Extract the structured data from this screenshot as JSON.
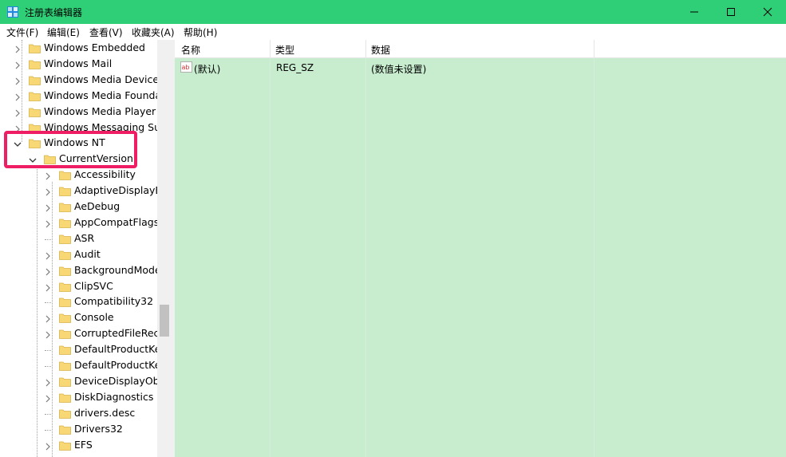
{
  "window": {
    "title": "注册表编辑器"
  },
  "menu": [
    "文件(F)",
    "编辑(E)",
    "查看(V)",
    "收藏夹(A)",
    "帮助(H)"
  ],
  "tree": {
    "top": [
      "Windows Embedded",
      "Windows Mail",
      "Windows Media Device M",
      "Windows Media Foundat",
      "Windows Media Player N",
      "Windows Messaging Sub"
    ],
    "expanded_parent": "Windows NT",
    "expanded_child": "CurrentVersion",
    "children": [
      {
        "label": "Accessibility",
        "expandable": true
      },
      {
        "label": "AdaptiveDisplayBr",
        "expandable": true
      },
      {
        "label": "AeDebug",
        "expandable": true
      },
      {
        "label": "AppCompatFlags",
        "expandable": true
      },
      {
        "label": "ASR",
        "expandable": false
      },
      {
        "label": "Audit",
        "expandable": true
      },
      {
        "label": "BackgroundMode",
        "expandable": true
      },
      {
        "label": "ClipSVC",
        "expandable": true
      },
      {
        "label": "Compatibility32",
        "expandable": false
      },
      {
        "label": "Console",
        "expandable": true
      },
      {
        "label": "CorruptedFileReco",
        "expandable": true
      },
      {
        "label": "DefaultProductKey",
        "expandable": false
      },
      {
        "label": "DefaultProductKey",
        "expandable": false
      },
      {
        "label": "DeviceDisplayObje",
        "expandable": true
      },
      {
        "label": "DiskDiagnostics",
        "expandable": true
      },
      {
        "label": "drivers.desc",
        "expandable": false
      },
      {
        "label": "Drivers32",
        "expandable": false
      },
      {
        "label": "EFS",
        "expandable": true
      }
    ]
  },
  "columns": [
    "名称",
    "类型",
    "数据"
  ],
  "values": [
    {
      "name": "(默认)",
      "type": "REG_SZ",
      "data": "(数值未设置)"
    }
  ],
  "colors": {
    "titlebar": "#2fcf78",
    "list_bg": "#c7ecce",
    "highlight": "#ef1d63",
    "folder": "#f8d775"
  }
}
